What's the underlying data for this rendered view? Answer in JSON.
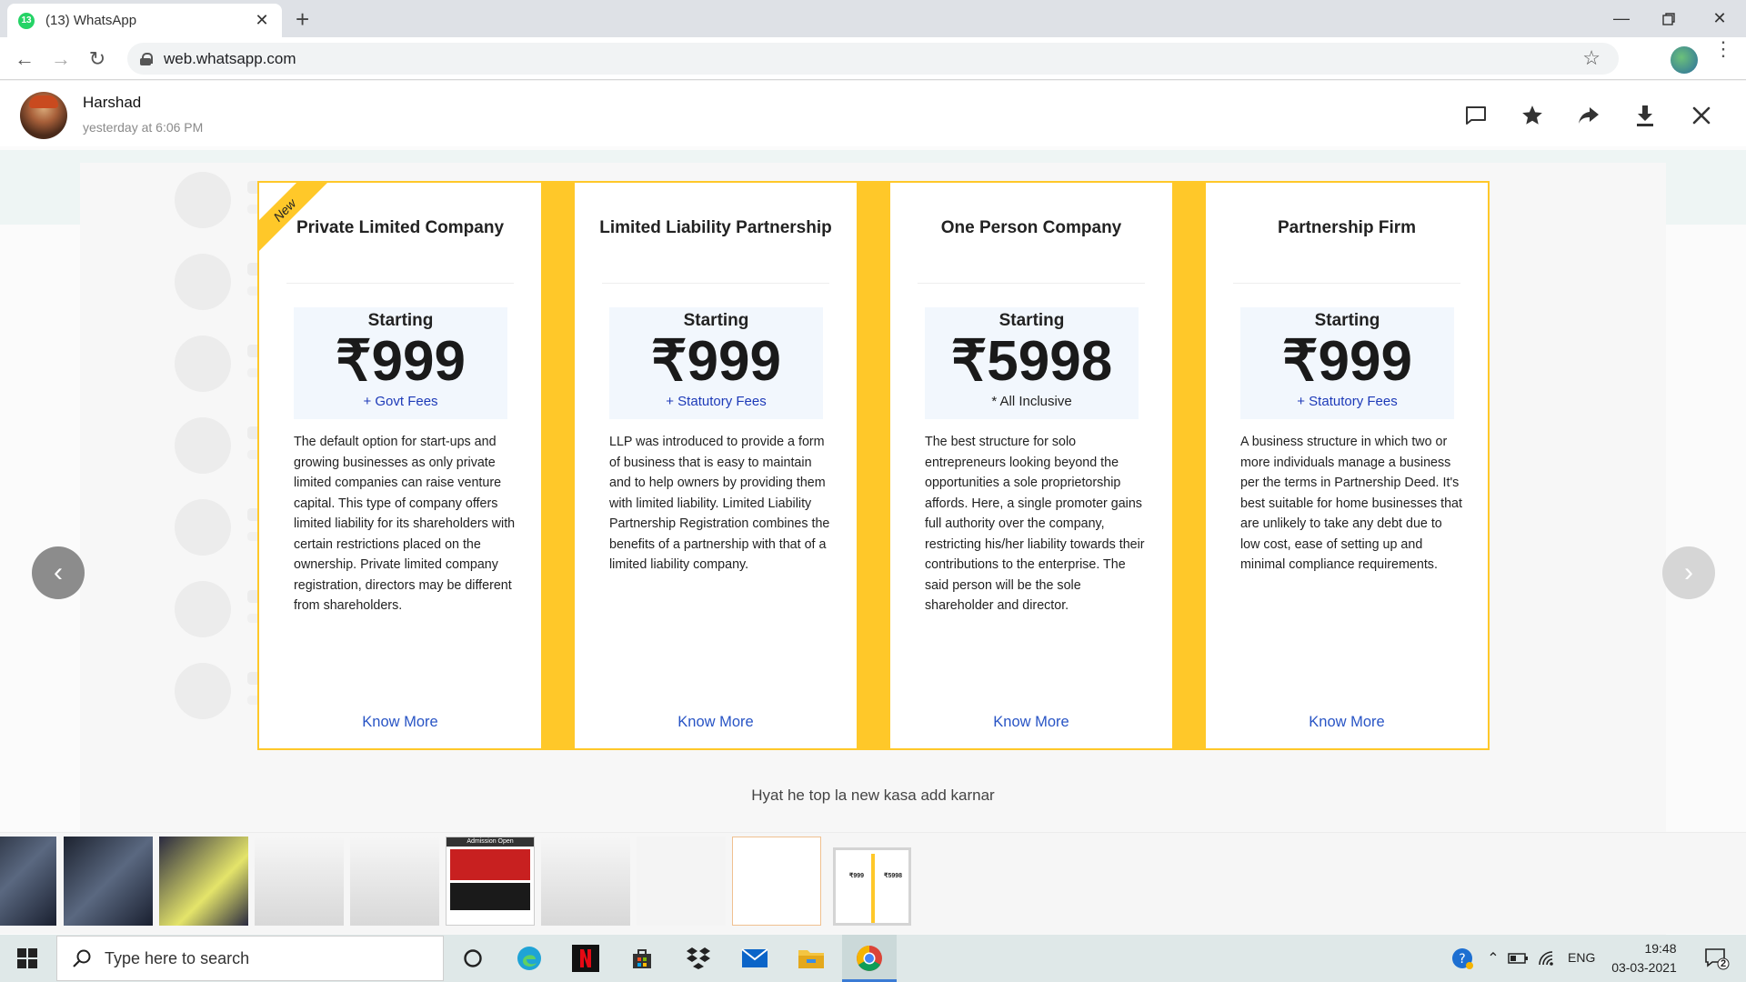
{
  "browser": {
    "tab_title": "(13) WhatsApp",
    "tab_badge": "13",
    "url": "web.whatsapp.com"
  },
  "viewer": {
    "sender_name": "Harshad",
    "sender_time": "yesterday at 6:06 PM",
    "caption": "Hyat he top la new kasa add karnar",
    "icons": [
      "message-icon",
      "star-icon",
      "forward-icon",
      "download-icon",
      "close-icon"
    ],
    "ribbon": "New",
    "cards": [
      {
        "title": "Private Limited Company",
        "starting": "Starting",
        "price": "₹999",
        "fees": "+ Govt Fees",
        "description": "The default option for start-ups and growing businesses as only private limited companies can raise venture capital. This type of company offers limited liability for its shareholders with certain restrictions placed on the ownership. Private limited company registration, directors may be different from shareholders.",
        "cta": "Know More"
      },
      {
        "title": "Limited Liability Partnership",
        "starting": "Starting",
        "price": "₹999",
        "fees": "+ Statutory Fees",
        "description": "LLP was introduced to provide a form of business that is easy to maintain and to help owners by providing them with limited liability. Limited Liability Partnership Registration combines the benefits of a partnership with that of a limited liability company.",
        "cta": "Know More"
      },
      {
        "title": "One Person Company",
        "starting": "Starting",
        "price": "₹5998",
        "fees": "* All Inclusive",
        "description": "The best structure for solo entrepreneurs looking beyond the opportunities a sole proprietorship affords. Here, a single promoter gains full authority over the company, restricting his/her liability towards their contributions to the enterprise. The said person will be the sole shareholder and director.",
        "cta": "Know More"
      },
      {
        "title": "Partnership Firm",
        "starting": "Starting",
        "price": "₹999",
        "fees": "+ Statutory Fees",
        "description": "A business structure in which two or more individuals manage a business per the terms in Partnership Deed. It's best suitable for home businesses that are unlikely to take any debt due to low cost, ease of setting up and minimal compliance requirements.",
        "cta": "Know More"
      }
    ],
    "thumb_admission_title": "Admission Open",
    "thumb_mini_prices": [
      "₹999",
      "₹5998"
    ]
  },
  "taskbar": {
    "search_placeholder": "Type here to search",
    "language": "ENG",
    "time": "19:48",
    "date": "03-03-2021",
    "notification_count": "2"
  },
  "colors": {
    "accent_yellow": "#ffc829",
    "link_blue": "#2854c5",
    "fees_blue": "#1d3ab8",
    "price_bg": "#f2f7fd"
  }
}
